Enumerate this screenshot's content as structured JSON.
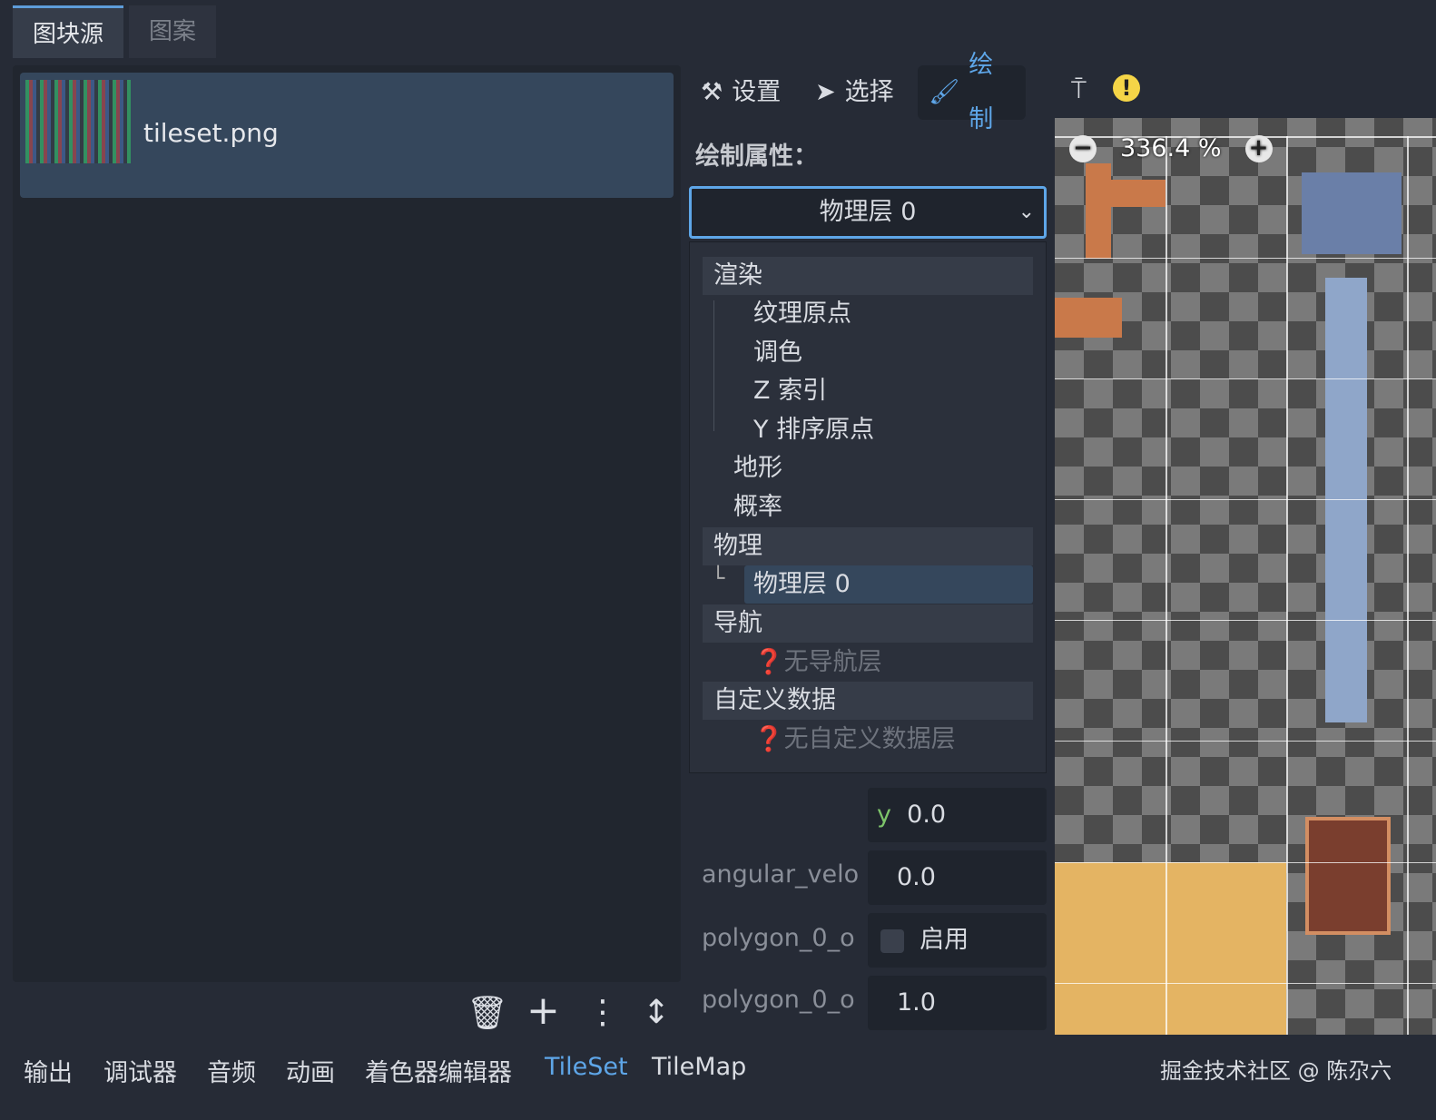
{
  "tabs": [
    {
      "label": "图块源",
      "active": true
    },
    {
      "label": "图案",
      "active": false
    }
  ],
  "source": {
    "name": "tileset.png"
  },
  "bottom_tools": [
    {
      "icon": "trash-icon",
      "glyph": "🗑"
    },
    {
      "icon": "plus-icon",
      "glyph": "+"
    },
    {
      "icon": "kebab-menu-icon",
      "glyph": "⋮"
    },
    {
      "icon": "sort-icon",
      "glyph": "↕"
    }
  ],
  "toolbar": {
    "settings": "设置",
    "select": "选择",
    "paint": "绘制",
    "accent": "#5ea6e8"
  },
  "paint_props_label": "绘制属性：",
  "dropdown": {
    "value": "物理层 0"
  },
  "menu": {
    "render": "渲染",
    "texture_origin": "纹理原点",
    "modulate": "调色",
    "z_index": "Z 索引",
    "y_sort_origin": "Y 排序原点",
    "terrain": "地形",
    "probability": "概率",
    "physics": "物理",
    "physics_layer": "物理层 0",
    "navigation": "导航",
    "no_nav": "无导航层",
    "custom_data": "自定义数据",
    "no_custom": "无自定义数据层"
  },
  "properties": [
    {
      "label": "",
      "axis": "y",
      "value": "0.0"
    },
    {
      "label": "angular_velo",
      "value": "0.0"
    },
    {
      "label": "polygon_0_o",
      "checkbox": "启用"
    },
    {
      "label": "polygon_0_o",
      "value": "1.0"
    }
  ],
  "zoom": {
    "level": "336.4 %"
  },
  "bottom_panel": [
    "输出",
    "调试器",
    "音频",
    "动画",
    "着色器编辑器",
    "TileSet",
    "TileMap"
  ],
  "bottom_active": "TileSet",
  "watermark": "掘金技术社区 @ 陈尕六"
}
